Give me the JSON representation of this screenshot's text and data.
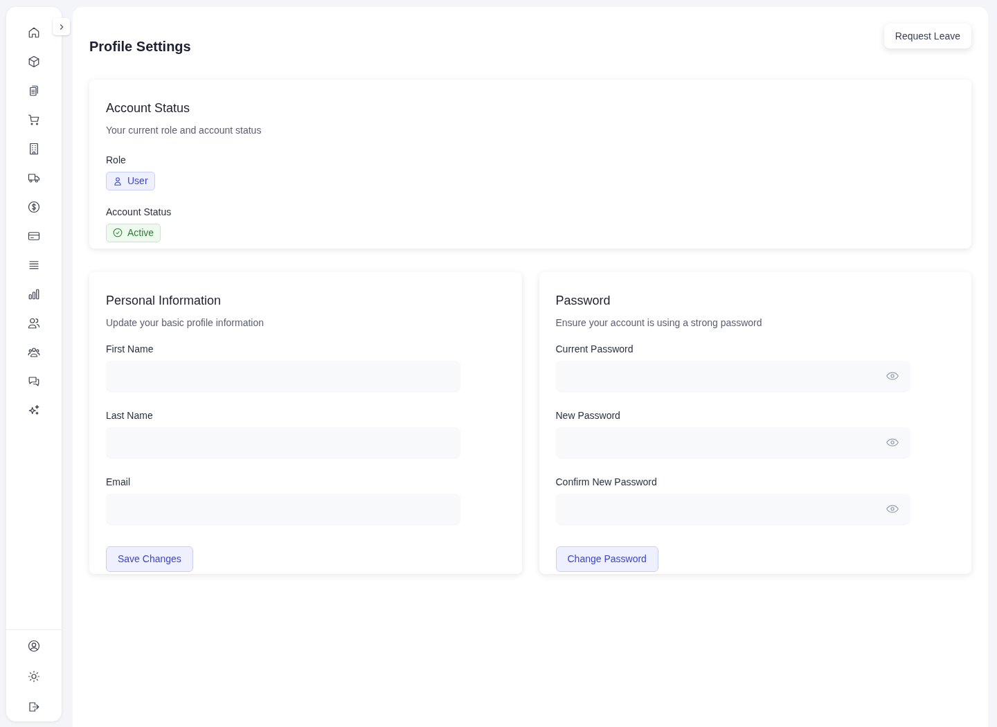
{
  "page_title": "Profile Settings",
  "header_button": "Request Leave",
  "account_card": {
    "title": "Account Status",
    "subtitle": "Your current role and account status",
    "badges": [
      {
        "label": "Role",
        "value": "User",
        "kind": "role"
      },
      {
        "label": "Account Status",
        "value": "Active",
        "kind": "status"
      }
    ]
  },
  "personal_card": {
    "title": "Personal Information",
    "subtitle": "Update your basic profile information",
    "fields": [
      {
        "label": "First Name"
      },
      {
        "label": "Last Name"
      },
      {
        "label": "Email"
      }
    ],
    "button": "Save Changes"
  },
  "password_card": {
    "title": "Password",
    "subtitle": "Ensure your account is using a strong password",
    "fields": [
      {
        "label": "Current Password",
        "kind": "password"
      },
      {
        "label": "New Password",
        "kind": "password"
      },
      {
        "label": "Confirm New Password",
        "kind": "password"
      }
    ],
    "button": "Change Password"
  }
}
